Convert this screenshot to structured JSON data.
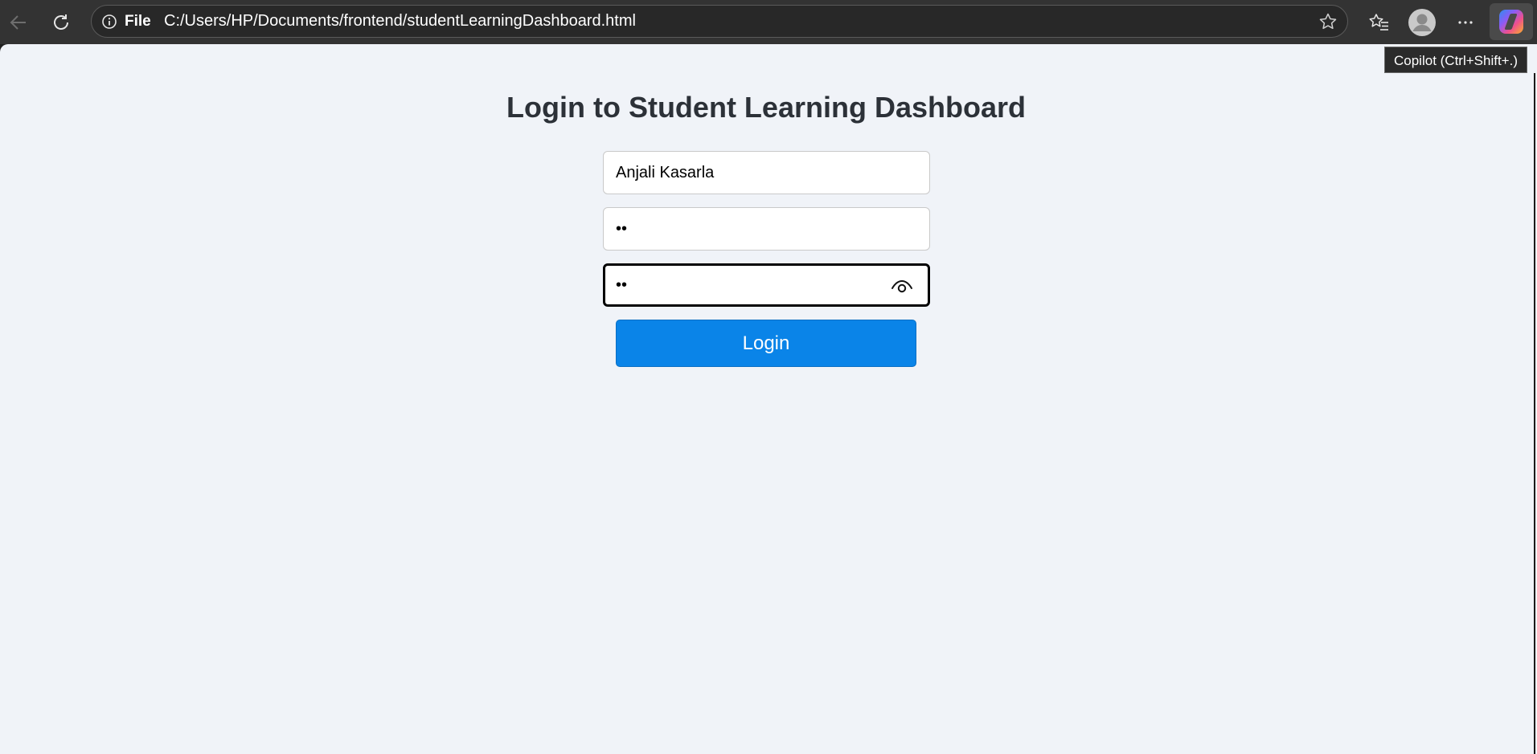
{
  "browser": {
    "address_scheme_label": "File",
    "url": "C:/Users/HP/Documents/frontend/studentLearningDashboard.html",
    "copilot_tooltip": "Copilot (Ctrl+Shift+.)",
    "icons": [
      "back-icon",
      "refresh-icon",
      "info-icon",
      "favorite-star-icon",
      "favorites-icon",
      "profile-icon",
      "more-icon",
      "copilot-icon"
    ]
  },
  "page": {
    "title": "Login to Student Learning Dashboard",
    "username_value": "Anjali Kasarla",
    "password_value": "••",
    "confirm_password_value": "••",
    "login_label": "Login"
  },
  "colors": {
    "page_background": "#f0f3f8",
    "button_blue": "#0a84e8",
    "title_color": "#2c3138"
  }
}
